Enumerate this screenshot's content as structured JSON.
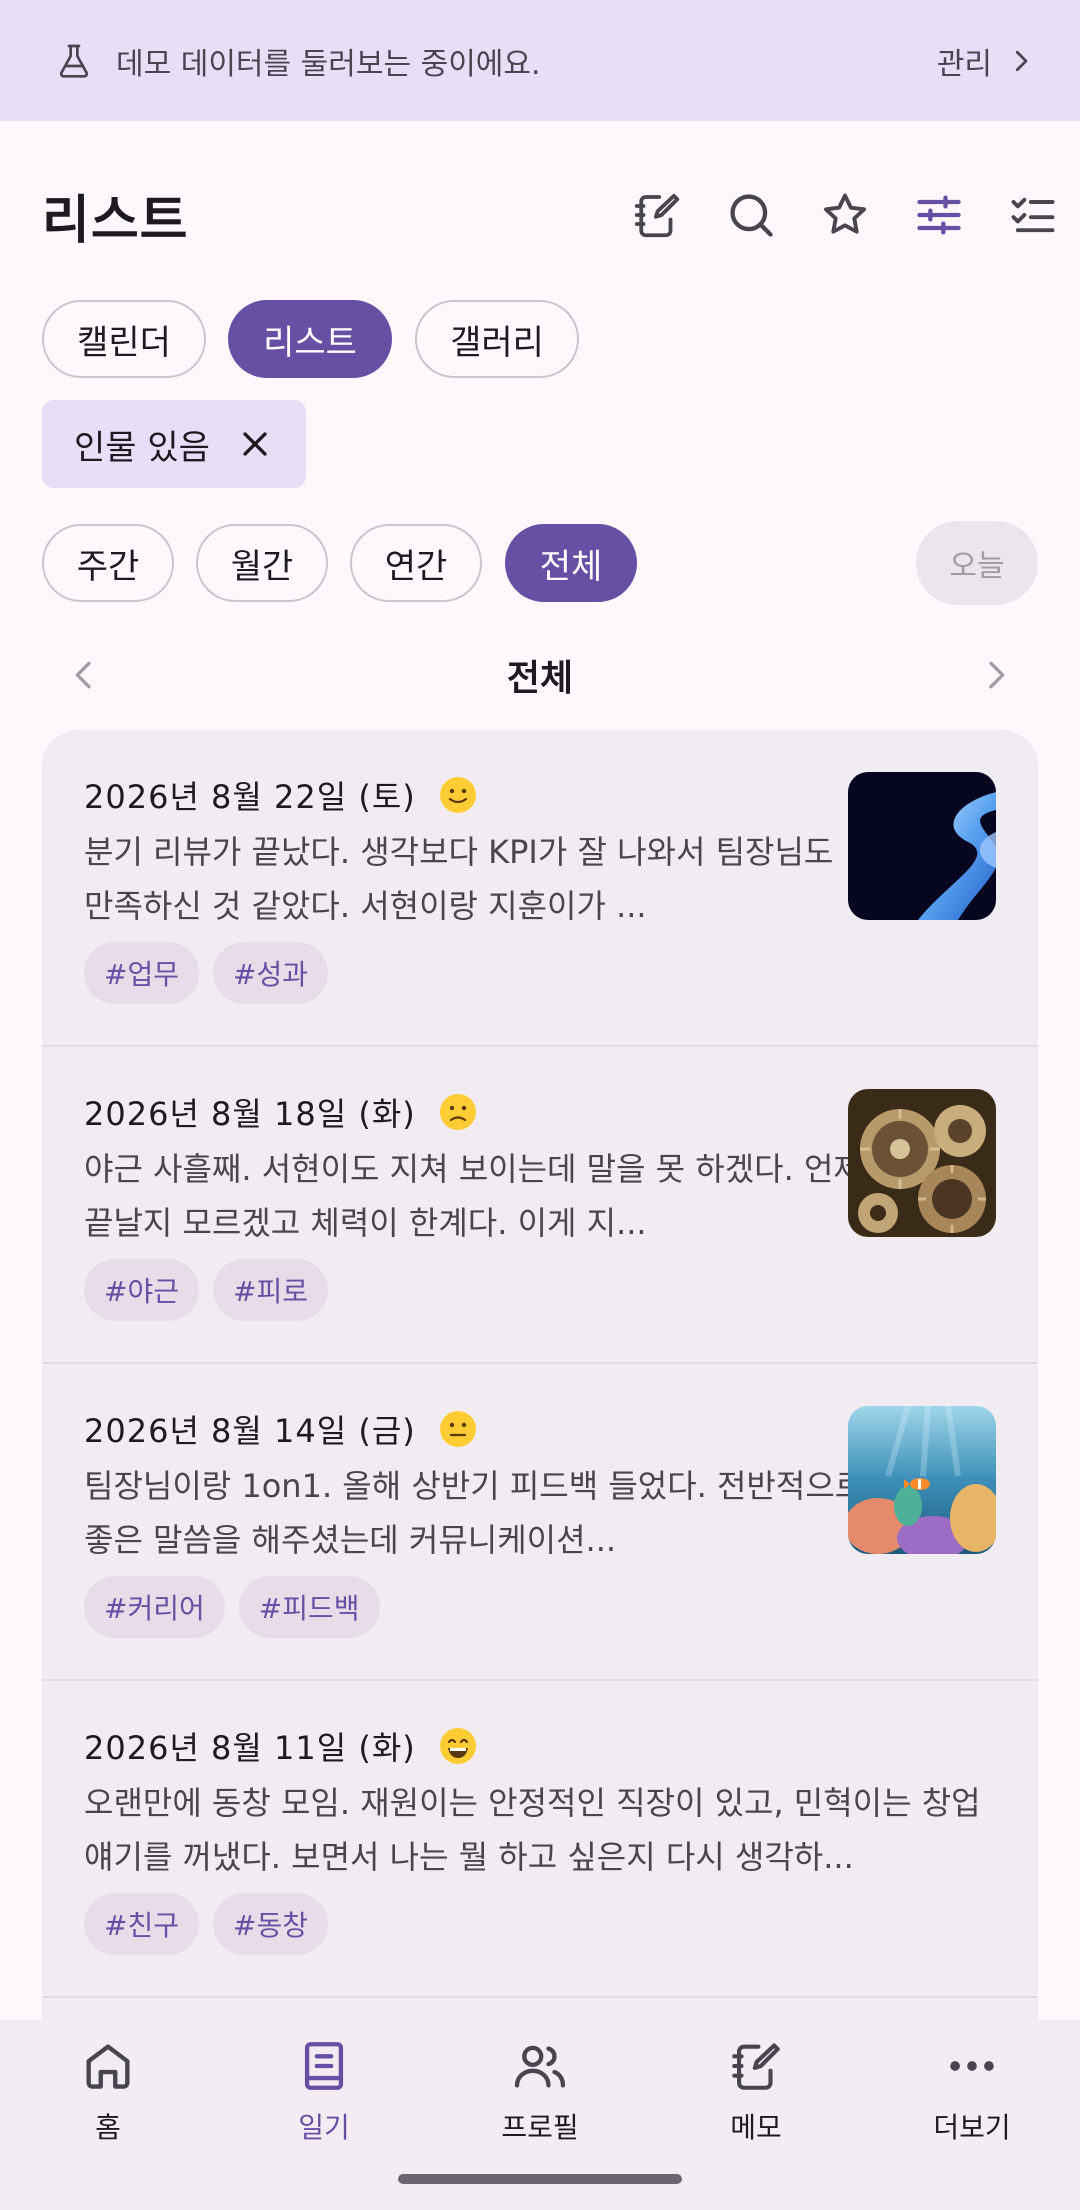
{
  "banner": {
    "text": "데모 데이터를 둘러보는 중이에요.",
    "manage_label": "관리"
  },
  "header": {
    "title": "리스트",
    "icons": [
      "edit-note-icon",
      "search-icon",
      "star-icon",
      "tune-icon",
      "checklist-icon"
    ]
  },
  "view_tabs": [
    {
      "label": "캘린더",
      "selected": false
    },
    {
      "label": "리스트",
      "selected": true
    },
    {
      "label": "갤러리",
      "selected": false
    }
  ],
  "filter": {
    "label": "인물 있음"
  },
  "period_tabs": [
    {
      "label": "주간",
      "selected": false
    },
    {
      "label": "월간",
      "selected": false
    },
    {
      "label": "연간",
      "selected": false
    },
    {
      "label": "전체",
      "selected": true
    }
  ],
  "today_label": "오늘",
  "period_nav": {
    "label": "전체"
  },
  "entries": [
    {
      "date": "2026년 8월 22일 (토)",
      "mood": "slight-smile",
      "body": "분기 리뷰가 끝났다. 생각보다 KPI가 잘 나와서 팀장님도 만족하신 것 같았다. 서현이랑 지훈이가 ...",
      "tags": [
        "#업무",
        "#성과"
      ],
      "thumbnail": "abstract-blue-ribbon"
    },
    {
      "date": "2026년 8월 18일 (화)",
      "mood": "slight-frown",
      "body": "야근 사흘째. 서현이도 지쳐 보이는데 말을 못 하겠다. 언제 끝날지 모르겠고 체력이 한계다. 이게 지...",
      "tags": [
        "#야근",
        "#피로"
      ],
      "thumbnail": "clockwork-gears"
    },
    {
      "date": "2026년 8월 14일 (금)",
      "mood": "neutral",
      "body": "팀장님이랑 1on1. 올해 상반기 피드백 들었다. 전반적으로 좋은 말씀을 해주셨는데 커뮤니케이션...",
      "tags": [
        "#커리어",
        "#피드백"
      ],
      "thumbnail": "coral-reef"
    },
    {
      "date": "2026년 8월 11일 (화)",
      "mood": "grin",
      "body": "오랜만에 동창 모임. 재원이는 안정적인 직장이 있고, 민혁이는 창업 얘기를 꺼냈다. 보면서 나는 뭘 하고 싶은지 다시 생각하...",
      "tags": [
        "#친구",
        "#동창"
      ],
      "thumbnail": null
    }
  ],
  "bottom_nav": [
    {
      "label": "홈",
      "icon": "home-icon",
      "active": false
    },
    {
      "label": "일기",
      "icon": "book-icon",
      "active": true
    },
    {
      "label": "프로필",
      "icon": "people-icon",
      "active": false
    },
    {
      "label": "메모",
      "icon": "memo-icon",
      "active": false
    },
    {
      "label": "더보기",
      "icon": "more-icon",
      "active": false
    }
  ],
  "colors": {
    "accent": "#6750a4",
    "banner_bg": "#e8def8",
    "card_bg": "#f1ecf1",
    "tag_bg": "#e6dde9"
  }
}
